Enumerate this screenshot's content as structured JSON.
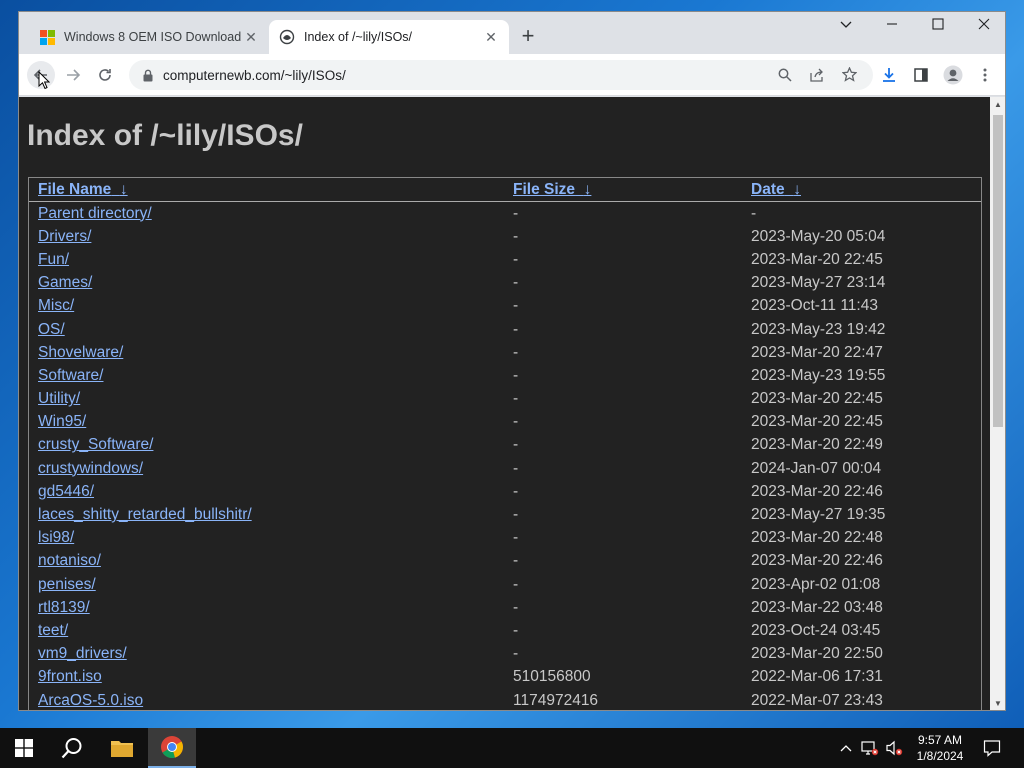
{
  "browser": {
    "tabs": [
      {
        "title": "Windows 8 OEM ISO Download",
        "active": false
      },
      {
        "title": "Index of /~lily/ISOs/",
        "active": true
      }
    ],
    "address": "computernewb.com/~lily/ISOs/"
  },
  "page": {
    "title": "Index of /~lily/ISOs/",
    "headers": {
      "name": "File Name",
      "size": "File Size",
      "date": "Date",
      "sort_arrow": "↓"
    },
    "rows": [
      {
        "name": "Parent directory/",
        "size": "-",
        "date": "-"
      },
      {
        "name": "Drivers/",
        "size": "-",
        "date": "2023-May-20 05:04"
      },
      {
        "name": "Fun/",
        "size": "-",
        "date": "2023-Mar-20 22:45"
      },
      {
        "name": "Games/",
        "size": "-",
        "date": "2023-May-27 23:14"
      },
      {
        "name": "Misc/",
        "size": "-",
        "date": "2023-Oct-11 11:43"
      },
      {
        "name": "OS/",
        "size": "-",
        "date": "2023-May-23 19:42"
      },
      {
        "name": "Shovelware/",
        "size": "-",
        "date": "2023-Mar-20 22:47"
      },
      {
        "name": "Software/",
        "size": "-",
        "date": "2023-May-23 19:55"
      },
      {
        "name": "Utility/",
        "size": "-",
        "date": "2023-Mar-20 22:45"
      },
      {
        "name": "Win95/",
        "size": "-",
        "date": "2023-Mar-20 22:45"
      },
      {
        "name": "crusty_Software/",
        "size": "-",
        "date": "2023-Mar-20 22:49"
      },
      {
        "name": "crustywindows/",
        "size": "-",
        "date": "2024-Jan-07 00:04"
      },
      {
        "name": "gd5446/",
        "size": "-",
        "date": "2023-Mar-20 22:46"
      },
      {
        "name": "laces_shitty_retarded_bullshitr/",
        "size": "-",
        "date": "2023-May-27 19:35"
      },
      {
        "name": "lsi98/",
        "size": "-",
        "date": "2023-Mar-20 22:48"
      },
      {
        "name": "notaniso/",
        "size": "-",
        "date": "2023-Mar-20 22:46"
      },
      {
        "name": "penises/",
        "size": "-",
        "date": "2023-Apr-02 01:08"
      },
      {
        "name": "rtl8139/",
        "size": "-",
        "date": "2023-Mar-22 03:48"
      },
      {
        "name": "teet/",
        "size": "-",
        "date": "2023-Oct-24 03:45"
      },
      {
        "name": "vm9_drivers/",
        "size": "-",
        "date": "2023-Mar-20 22:50"
      },
      {
        "name": "9front.iso",
        "size": "510156800",
        "date": "2022-Mar-06 17:31"
      },
      {
        "name": "ArcaOS-5.0.iso",
        "size": "1174972416",
        "date": "2022-Mar-07 23:43"
      }
    ]
  },
  "taskbar": {
    "time": "9:57 AM",
    "date": "1/8/2024"
  },
  "colors": {
    "page_bg": "#222222",
    "link": "#8ab4f8",
    "text": "#c8c8c8",
    "taskbar": "#101010"
  },
  "icons": {
    "back": "arrow-left-icon",
    "forward": "arrow-right-icon",
    "reload": "reload-icon",
    "lock": "lock-icon",
    "search": "search-icon",
    "share": "share-icon",
    "bookmark": "star-icon",
    "download": "download-icon",
    "side_panel": "side-panel-icon",
    "profile": "profile-icon",
    "menu": "kebab-menu-icon"
  }
}
